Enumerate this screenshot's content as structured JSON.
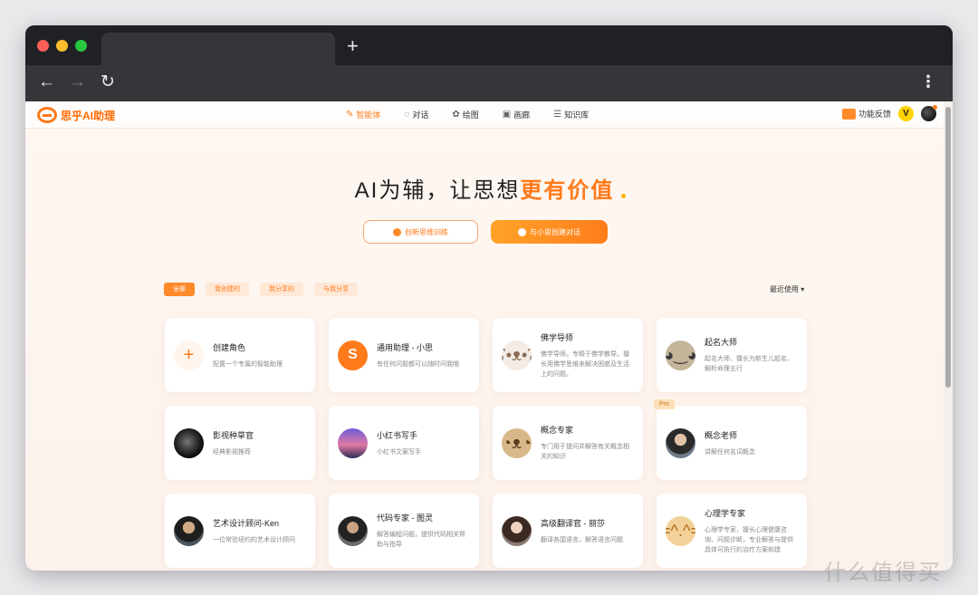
{
  "browser": {
    "new_tab": "+",
    "back": "←",
    "forward": "→",
    "reload": "↻",
    "menu": "⋮"
  },
  "brand": {
    "name": "思乎AI助理",
    "accent": "#ff7a1a"
  },
  "nav": {
    "items": [
      {
        "label": "智能体",
        "icon": "sparkle-pen-icon",
        "glyph": "✎",
        "active": true
      },
      {
        "label": "对话",
        "icon": "chat-bubble-icon",
        "glyph": "◌"
      },
      {
        "label": "绘图",
        "icon": "palette-icon",
        "glyph": "✿"
      },
      {
        "label": "画廊",
        "icon": "gallery-icon",
        "glyph": "▣"
      },
      {
        "label": "知识库",
        "icon": "database-icon",
        "glyph": "☰"
      }
    ],
    "feedback": "功能反馈",
    "vip": "V"
  },
  "hero": {
    "prefix": "AI为辅，让思想",
    "highlight": "更有价值"
  },
  "cta": {
    "outline_label": "创新思维训练",
    "solid_label": "与小思创建对话"
  },
  "filters": {
    "chips": [
      "全部",
      "我创建的",
      "我分享的",
      "与我分享"
    ],
    "sort": "最近使用 ▾"
  },
  "cards": [
    {
      "title": "创建角色",
      "desc": "配置一个专属的智能助理",
      "avatar": "plus-icon",
      "glyph": "+"
    },
    {
      "title": "通用助理 - 小思",
      "desc": "有任何问题都可以随时问我哦",
      "avatar": "brand-logo-avatar",
      "glyph": "S"
    },
    {
      "title": "佛学导师",
      "desc": "佛学导师。专精于佛学教导。擅长用佛学思维来解决困惑及生活上的问题。",
      "avatar": "bear-avatar",
      "glyph": "ʕ•ᴥ•ʔ"
    },
    {
      "title": "起名大师",
      "desc": "起名大师，擅长为新生儿起名、解析命理五行",
      "avatar": "panda-avatar",
      "glyph": "◕‿◕"
    },
    {
      "title": "影视种草官",
      "desc": "经典影视推荐",
      "avatar": "moon-avatar",
      "glyph": ""
    },
    {
      "title": "小红书写手",
      "desc": "小红书文案写手",
      "avatar": "sunset-avatar",
      "glyph": ""
    },
    {
      "title": "概念专家",
      "desc": "专门用于提问并解答有关概念相关的知识",
      "avatar": "dog-avatar",
      "glyph": "◔ᴥ◔"
    },
    {
      "title": "概念老师",
      "desc": "讲解任何名词概念",
      "avatar": "person-avatar",
      "glyph": "",
      "badge": "Pro"
    },
    {
      "title": "艺术设计顾问-Ken",
      "desc": "一位常驻纽约的艺术设计顾问",
      "avatar": "person-avatar",
      "glyph": ""
    },
    {
      "title": "代码专家 - 图灵",
      "desc": "解答编程问题，提供代码相关帮助与指导",
      "avatar": "person-avatar",
      "glyph": ""
    },
    {
      "title": "高级翻译官 - 丽莎",
      "desc": "翻译各国语言，解答语言问题",
      "avatar": "person-avatar",
      "glyph": ""
    },
    {
      "title": "心理学专家",
      "desc": "心理学专家，擅长心理健康咨询、问题诊断，专业解答与提供具体可执行的治疗方案和建",
      "avatar": "cat-avatar",
      "glyph": "=^.^="
    }
  ],
  "watermark": "什么值得买"
}
